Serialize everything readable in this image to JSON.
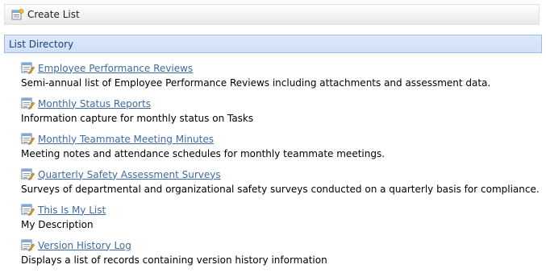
{
  "toolbar": {
    "create_list_label": "Create List",
    "icon": "create-list-icon"
  },
  "section": {
    "title": "List Directory"
  },
  "lists": [
    {
      "title": "Employee Performance Reviews",
      "description": "Semi-annual list of Employee Performance Reviews including attachments and assessment data.",
      "icon": "list-icon"
    },
    {
      "title": "Monthly Status Reports",
      "description": "Information capture for monthly status on Tasks",
      "icon": "list-icon"
    },
    {
      "title": "Monthly Teammate Meeting Minutes",
      "description": "Meeting notes and attendance schedules for monthly teammate meetings.",
      "icon": "list-icon"
    },
    {
      "title": "Quarterly Safety Assessment Surveys",
      "description": "Surveys of departmental and organizational safety surveys conducted on a quarterly basis for compliance.",
      "icon": "list-icon"
    },
    {
      "title": "This Is My List",
      "description": "My Description",
      "icon": "list-icon"
    },
    {
      "title": "Version History Log",
      "description": "Displays a list of records containing version history information",
      "icon": "list-icon"
    }
  ],
  "colors": {
    "link": "#3f6aa3",
    "header_bg": "#cfe0f8",
    "header_border": "#9ebbe6",
    "header_text": "#1c3f75"
  }
}
